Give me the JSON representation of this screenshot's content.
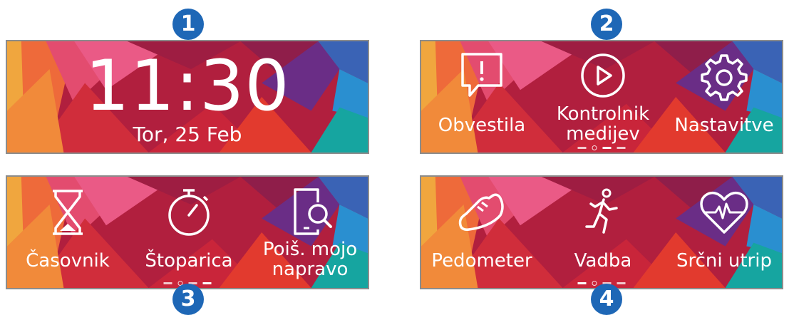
{
  "markers": [
    "1",
    "2",
    "3",
    "4"
  ],
  "panel1": {
    "time": "11:30",
    "date": "Tor, 25 Feb"
  },
  "panel2": {
    "items": [
      {
        "label": "Obvestila",
        "icon": "notification-bubble-icon"
      },
      {
        "label": "Kontrolnik medijev",
        "icon": "play-circle-icon"
      },
      {
        "label": "Nastavitve",
        "icon": "gear-icon"
      }
    ]
  },
  "panel3": {
    "items": [
      {
        "label": "Časovnik",
        "icon": "hourglass-icon"
      },
      {
        "label": "Štoparica",
        "icon": "stopwatch-icon"
      },
      {
        "label": "Poiš. mojo napravo",
        "icon": "find-device-icon"
      }
    ]
  },
  "panel4": {
    "items": [
      {
        "label": "Pedometer",
        "icon": "shoe-icon"
      },
      {
        "label": "Vadba",
        "icon": "running-person-icon"
      },
      {
        "label": "Srčni utrip",
        "icon": "heart-rate-icon"
      }
    ]
  },
  "colors": {
    "marker": "#1e67b6",
    "text": "#ffffff",
    "wallpaper_main": "#b5253f"
  }
}
